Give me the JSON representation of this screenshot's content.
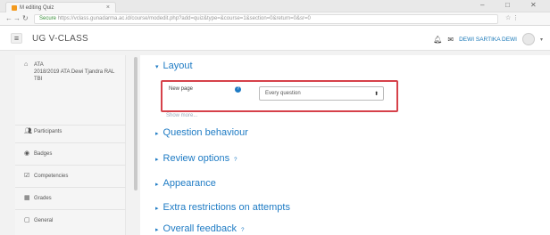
{
  "browser": {
    "tab_title": "M editing Quiz",
    "url_prefix": "Secure",
    "url": "https://vclass.gunadarma.ac.id/course/modedit.php?add=quiz&type=&course=1&section=0&return=0&sr=0",
    "window_controls": [
      "–",
      "□",
      "✕"
    ]
  },
  "navbar": {
    "site_name": "UG V-CLASS",
    "user_name": "DEWI SARTIKA DEWI"
  },
  "sidebar": {
    "course": {
      "code": "ATA",
      "text": "2018/2019 ATA Dewi Tjandra RAL TBI"
    },
    "items": [
      {
        "label": "Participants",
        "icon": "people-icon"
      },
      {
        "label": "Badges",
        "icon": "badge-icon"
      },
      {
        "label": "Competencies",
        "icon": "checklist-icon"
      },
      {
        "label": "Grades",
        "icon": "grades-icon"
      },
      {
        "label": "General",
        "icon": "folder-icon"
      }
    ]
  },
  "main": {
    "layout_label": "Layout",
    "new_page_label": "New page",
    "new_page_value": "Every question",
    "show_more": "Show more...",
    "sections": [
      "Question behaviour",
      "Review options",
      "Appearance",
      "Extra restrictions on attempts",
      "Overall feedback"
    ]
  }
}
